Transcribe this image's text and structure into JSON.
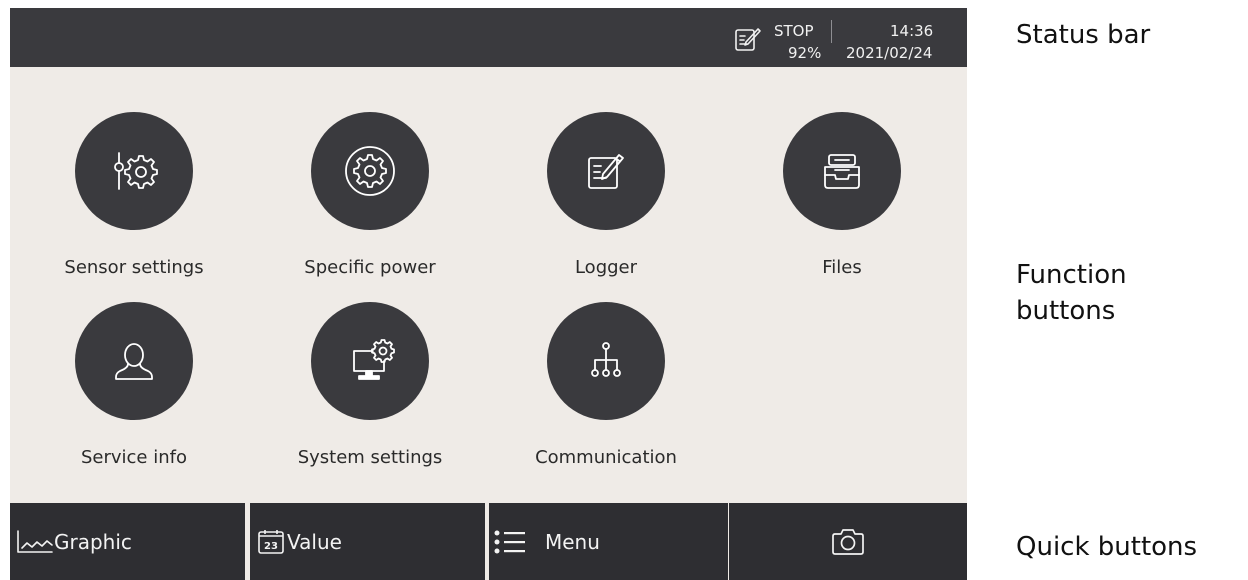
{
  "status_bar": {
    "state": "STOP",
    "percent": "92%",
    "time": "14:36",
    "date": "2021/02/24"
  },
  "functions": [
    {
      "label": "Sensor settings",
      "icon": "sensor-settings-icon"
    },
    {
      "label": "Specific power",
      "icon": "specific-power-icon"
    },
    {
      "label": "Logger",
      "icon": "logger-icon"
    },
    {
      "label": "Files",
      "icon": "files-icon"
    },
    {
      "label": "Service info",
      "icon": "service-info-icon"
    },
    {
      "label": "System settings",
      "icon": "system-settings-icon"
    },
    {
      "label": "Communication",
      "icon": "communication-icon"
    }
  ],
  "quick": [
    {
      "label": "Graphic",
      "icon": "graphic-icon"
    },
    {
      "label": "Value",
      "icon": "value-icon",
      "icon_text": "23"
    },
    {
      "label": "Menu",
      "icon": "menu-icon"
    },
    {
      "label": "",
      "icon": "camera-icon"
    }
  ],
  "annotations": {
    "status_bar": "Status bar",
    "function_buttons": "Function buttons",
    "quick_buttons": "Quick buttons"
  },
  "colors": {
    "status_bar_bg": "#3a3a3e",
    "screen_bg": "#efebe7",
    "circle_bg": "#3a3a3e",
    "quick_bar_bg": "#2e2e32"
  }
}
